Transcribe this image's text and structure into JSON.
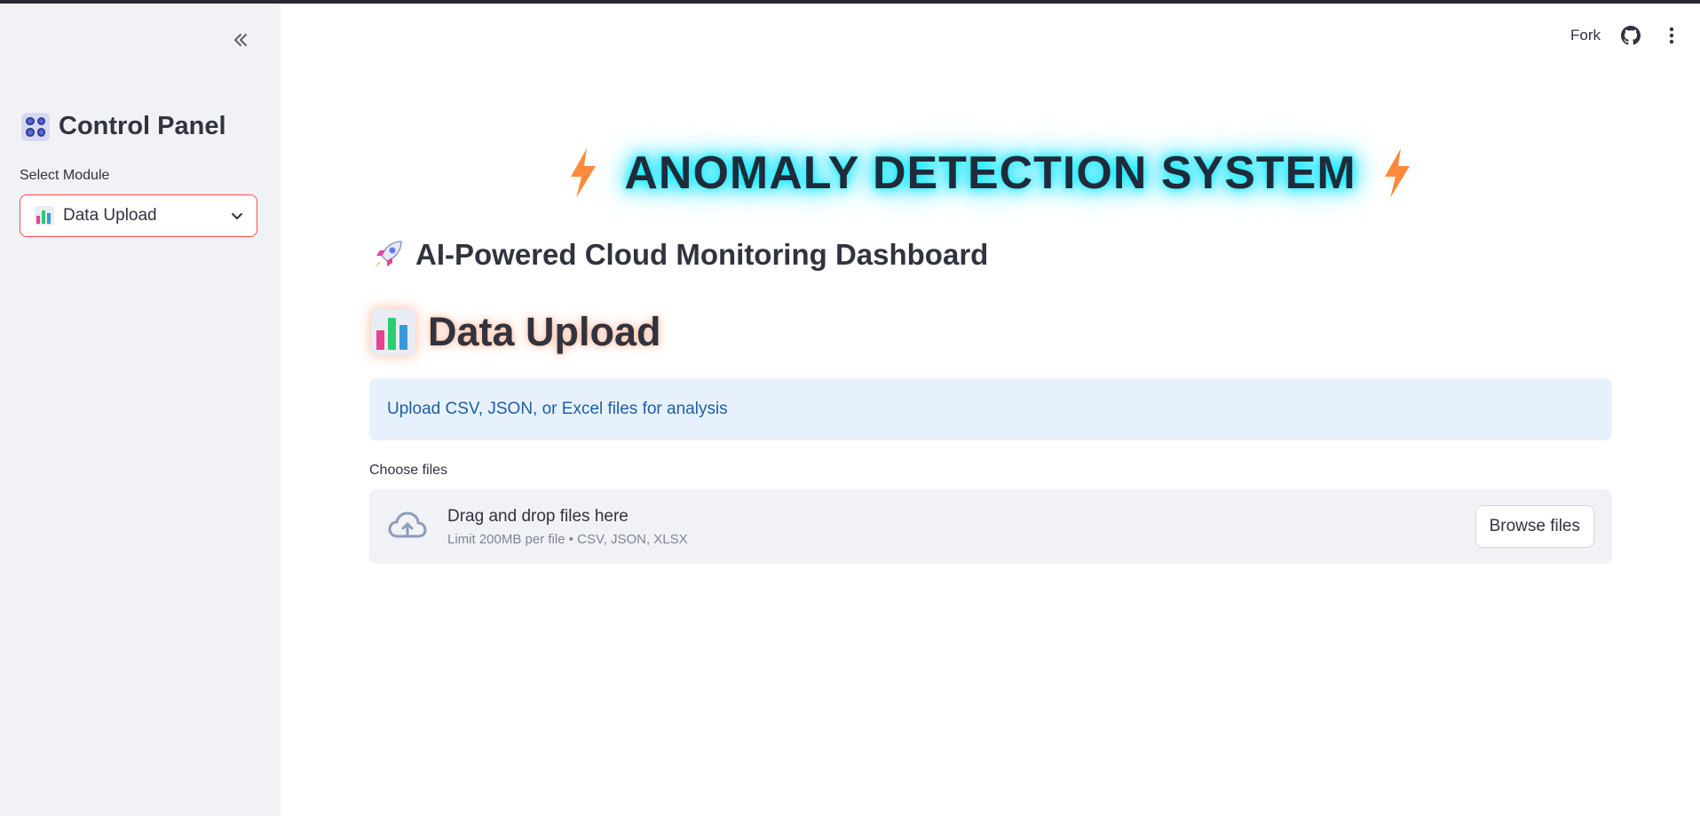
{
  "sidebar": {
    "title": "Control Panel",
    "select_label": "Select Module",
    "selected_module": "Data Upload",
    "panel_icon": "control-panel-icon",
    "module_icon": "bar-chart-icon"
  },
  "header": {
    "fork_label": "Fork"
  },
  "main": {
    "title": "ANOMALY DETECTION SYSTEM",
    "subtitle": "AI-Powered Cloud Monitoring Dashboard",
    "section_title": "Data Upload",
    "info_text": "Upload CSV, JSON, or Excel files for analysis",
    "uploader": {
      "label": "Choose files",
      "drop_text": "Drag and drop files here",
      "limit_text": "Limit 200MB per file • CSV, JSON, XLSX",
      "browse_label": "Browse files"
    }
  },
  "colors": {
    "accent": "#ff4b4b",
    "title_glow": "#00e5ff",
    "info_bg": "#e7f1fd",
    "info_text": "#1d5fa3",
    "sidebar_bg": "#f0f2f6"
  }
}
